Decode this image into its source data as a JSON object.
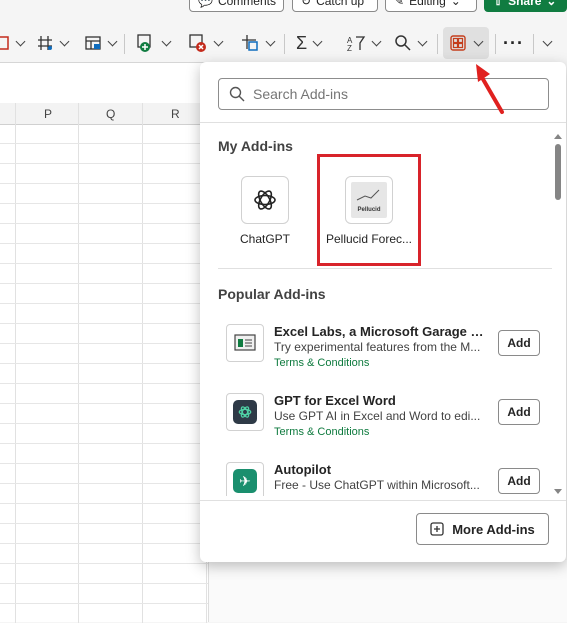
{
  "topbar": {
    "comments_label": "Comments",
    "catchup_label": "Catch up",
    "editing_label": "Editing",
    "share_label": "Share"
  },
  "sheet": {
    "columns": [
      "P",
      "Q",
      "R"
    ]
  },
  "popup": {
    "search_placeholder": "Search Add-ins",
    "my_addins_heading": "My Add-ins",
    "my_addins": [
      {
        "label": "ChatGPT",
        "icon": "openai-icon"
      },
      {
        "label": "Pellucid Forec...",
        "icon": "pellucid-icon",
        "logo_text": "Pellucid"
      }
    ],
    "popular_heading": "Popular Add-ins",
    "popular": [
      {
        "title": "Excel Labs, a Microsoft Garage pr...",
        "desc": "Try experimental features from the M...",
        "terms": "Terms & Conditions",
        "button": "Add",
        "icon": "excel-labs-icon"
      },
      {
        "title": "GPT for Excel Word",
        "desc": "Use GPT AI in Excel and Word to edi...",
        "terms": "Terms & Conditions",
        "button": "Add",
        "icon": "gpt-word-icon"
      },
      {
        "title": "Autopilot",
        "desc": "Free - Use ChatGPT within Microsoft...",
        "terms": "",
        "button": "Add",
        "icon": "autopilot-icon"
      }
    ],
    "more_label": "More Add-ins"
  },
  "colors": {
    "accent_green": "#107c41",
    "highlight_red": "#d8232a",
    "terms_green": "#0e7a3e"
  }
}
